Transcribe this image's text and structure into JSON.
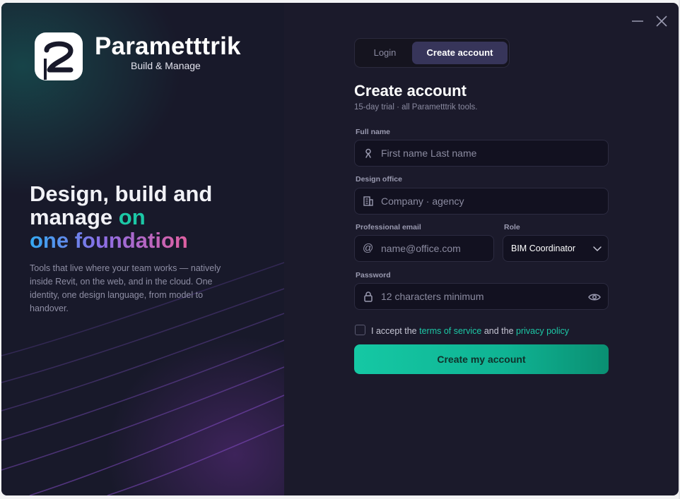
{
  "brand": {
    "name": "Parametttrik",
    "tagline": "Build & Manage"
  },
  "hero": {
    "line1": "Design, build and",
    "line2_white": "manage",
    "line2_teal": "on",
    "line3_gradient": "one foundation",
    "description": "Tools that live where your team works — natively inside Revit, on the web, and in the cloud. One identity, one design language, from model to handover."
  },
  "tabs": [
    {
      "label": "Login",
      "active": false
    },
    {
      "label": "Create account",
      "active": true
    }
  ],
  "form": {
    "title": "Create account",
    "subtitle": "15-day trial · all Parametttrik tools.",
    "full_name": {
      "label": "Full name",
      "placeholder": "First name Last name",
      "value": ""
    },
    "office": {
      "label": "Design office",
      "placeholder": "Company · agency",
      "value": ""
    },
    "email": {
      "label": "Professional email",
      "placeholder": "name@office.com",
      "value": ""
    },
    "role": {
      "label": "Role",
      "value": "BIM Coordinator"
    },
    "password": {
      "label": "Password",
      "placeholder": "12 characters minimum",
      "value": ""
    },
    "terms": {
      "prefix": "I accept the",
      "terms_link": "terms of service",
      "middle": "and the",
      "privacy_link": "privacy policy",
      "checked": false
    },
    "submit_label": "Create my account",
    "email_icon_glyph": "@"
  },
  "icons": {
    "minimize": "minimize-icon",
    "close": "close-icon",
    "name_field": "user-icon",
    "office_field": "building-icon",
    "email_field": "at-icon",
    "role_dropdown": "chevron-down-icon",
    "password_field": "lock-icon",
    "password_toggle": "eye-icon"
  },
  "colors": {
    "accent": "#1cc8a6",
    "background": "#1b1a2b",
    "tab_active": "#37355a",
    "field_bg": "#121120"
  }
}
